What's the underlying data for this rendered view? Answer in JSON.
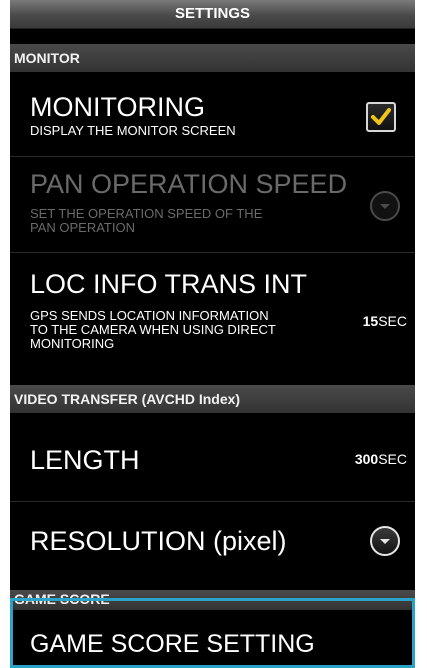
{
  "topbar": {
    "title": "SETTINGS"
  },
  "sections": {
    "monitor": "MONITOR",
    "video_transfer": "VIDEO TRANSFER (AVCHD Index)",
    "game_score": "GAME SCORE"
  },
  "items": {
    "monitoring": {
      "title": "MONITORING",
      "desc": "DISPLAY THE MONITOR SCREEN",
      "checked": true
    },
    "pan_speed": {
      "title": "PAN OPERATION SPEED",
      "desc_line1": "SET THE OPERATION SPEED OF THE",
      "desc_line2": "PAN OPERATION"
    },
    "loc_info": {
      "title": "LOC INFO TRANS INT",
      "desc_line1": "GPS SENDS LOCATION INFORMATION",
      "desc_line2": "TO THE CAMERA WHEN USING DIRECT",
      "desc_line3": "MONITORING",
      "value": "15",
      "unit": "SEC"
    },
    "length": {
      "title": "LENGTH",
      "value": "300",
      "unit": "SEC"
    },
    "resolution": {
      "title": "RESOLUTION (pixel)"
    },
    "game_score_setting": {
      "title": "GAME SCORE SETTING"
    }
  },
  "colors": {
    "accent": "#2aa3c9",
    "check": "#f0c419",
    "disabled_text": "#6a6a6a"
  }
}
